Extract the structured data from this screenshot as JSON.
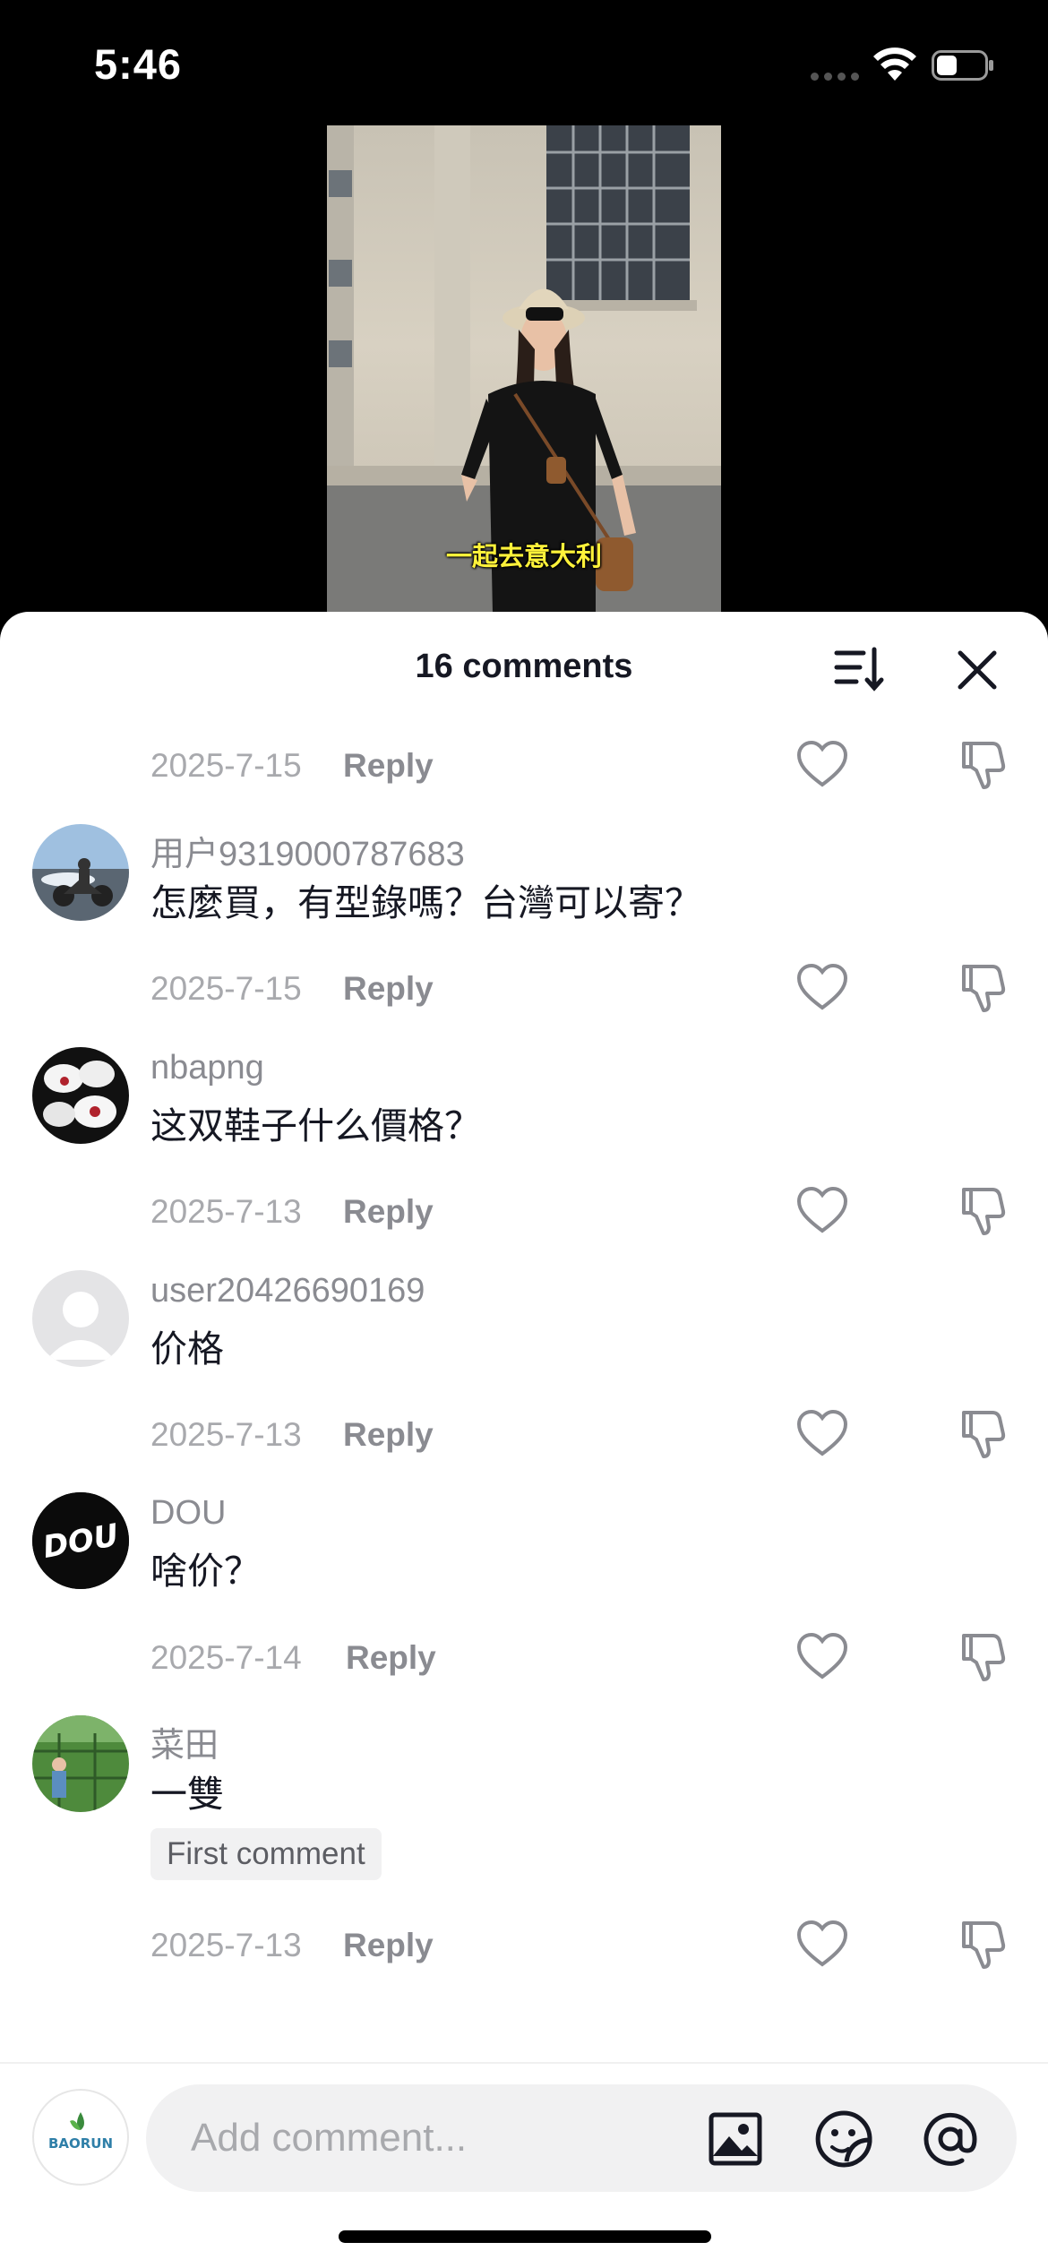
{
  "status_bar": {
    "time": "5:46"
  },
  "video": {
    "caption": "一起去意大利"
  },
  "sheet": {
    "title": "16 comments"
  },
  "top_meta": {
    "date": "2025-7-15",
    "reply": "Reply"
  },
  "comments": [
    {
      "username": "用户9319000787683",
      "text": "怎麼買，有型錄嗎？台灣可以寄？",
      "date": "2025-7-15",
      "reply": "Reply"
    },
    {
      "username": "nbapng",
      "text": "这双鞋子什么價格？",
      "date": "2025-7-13",
      "reply": "Reply"
    },
    {
      "username": "user20426690169",
      "text": "价格",
      "date": "2025-7-13",
      "reply": "Reply"
    },
    {
      "username": "DOU",
      "text": "啥价？",
      "date": "2025-7-14",
      "reply": "Reply"
    },
    {
      "username": "菜田",
      "text": "一雙",
      "badge": "First comment",
      "date": "2025-7-13",
      "reply": "Reply"
    }
  ],
  "avatars": {
    "dou_logo": "DOU",
    "my_logo": "BAORUN"
  },
  "input": {
    "placeholder": "Add comment..."
  },
  "icons": {
    "sort": "sort-icon",
    "close": "close-icon",
    "like": "heart-outline-icon",
    "dislike": "thumbs-down-icon",
    "image": "image-icon",
    "sticker": "sticker-icon",
    "mention": "at-icon"
  }
}
